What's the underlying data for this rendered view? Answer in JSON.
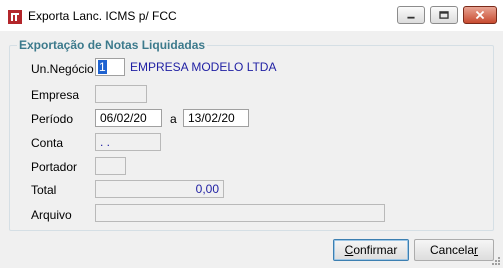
{
  "window": {
    "title": "Exporta Lanc. ICMS p/ FCC",
    "icon": "app-logo-icon",
    "controls": [
      "minimize-icon",
      "maximize-icon",
      "close-icon"
    ]
  },
  "group": {
    "title": "Exportação de Notas Liquidadas"
  },
  "form": {
    "un_negocio": {
      "label": "Un.Negócio",
      "code": "1",
      "name": "EMPRESA MODELO LTDA"
    },
    "empresa": {
      "label": "Empresa",
      "value": ""
    },
    "periodo": {
      "label": "Período",
      "start": "06/02/20",
      "separator": "a",
      "end": "13/02/20"
    },
    "conta": {
      "label": "Conta",
      "value": ". ."
    },
    "portador": {
      "label": "Portador",
      "value": ""
    },
    "total": {
      "label": "Total",
      "value": "0,00"
    },
    "arquivo": {
      "label": "Arquivo",
      "value": ""
    }
  },
  "buttons": {
    "confirm": {
      "label_first": "C",
      "label_rest": "onfirmar"
    },
    "cancel": {
      "label_first": "Cancela",
      "label_underlined": "r"
    }
  },
  "colors": {
    "group_title": "#3c7a8c",
    "value_text": "#1f1fa3",
    "selection": "#1e62d0"
  }
}
